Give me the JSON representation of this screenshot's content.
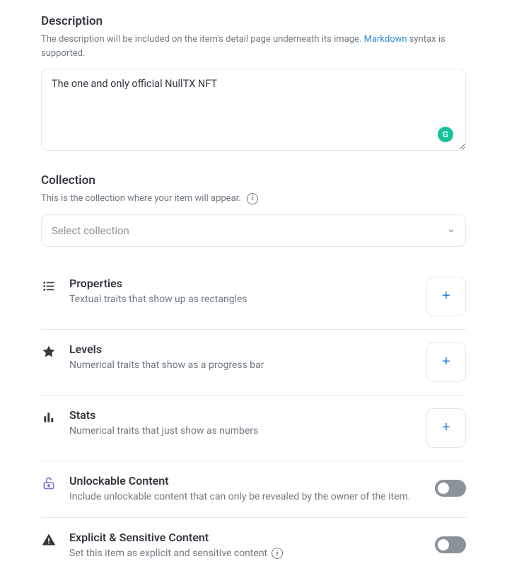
{
  "description": {
    "title": "Description",
    "subtitle_before": "The description will be included on the item's detail page underneath its image. ",
    "markdown_link": "Markdown",
    "subtitle_after": " syntax is supported.",
    "value": "The one and only official NullTX NFT"
  },
  "collection": {
    "title": "Collection",
    "subtitle": "This is the collection where your item will appear.",
    "placeholder": "Select collection"
  },
  "traits": {
    "properties": {
      "title": "Properties",
      "desc": "Textual traits that show up as rectangles"
    },
    "levels": {
      "title": "Levels",
      "desc": "Numerical traits that show as a progress bar"
    },
    "stats": {
      "title": "Stats",
      "desc": "Numerical traits that just show as numbers"
    },
    "unlockable": {
      "title": "Unlockable Content",
      "desc": "Include unlockable content that can only be revealed by the owner of the item."
    },
    "explicit": {
      "title": "Explicit & Sensitive Content",
      "desc": "Set this item as explicit and sensitive content"
    }
  }
}
